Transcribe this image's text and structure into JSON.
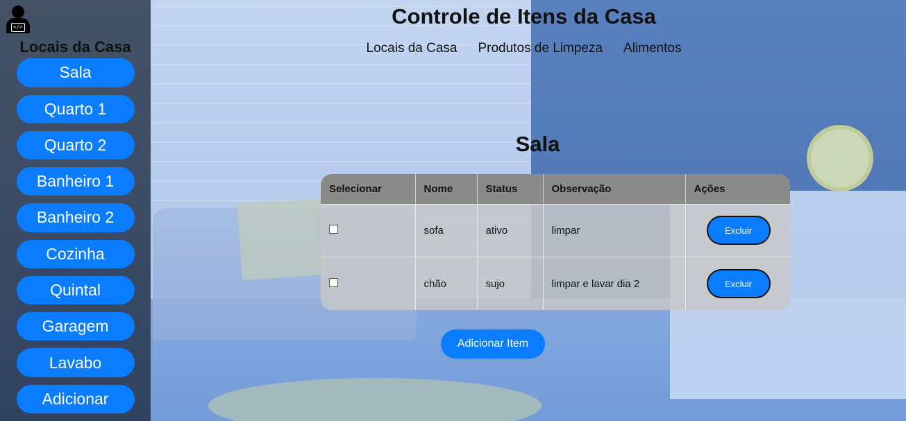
{
  "header": {
    "title": "Controle de Itens da Casa",
    "nav": [
      "Locais da Casa",
      "Produtos de Limpeza",
      "Alimentos"
    ]
  },
  "sidebar": {
    "title": "Locais da Casa",
    "icon": "user-laptop-icon",
    "items": [
      "Sala",
      "Quarto 1",
      "Quarto 2",
      "Banheiro 1",
      "Banheiro 2",
      "Cozinha",
      "Quintal",
      "Garagem",
      "Lavabo",
      "Adicionar"
    ]
  },
  "main": {
    "section_title": "Sala",
    "table": {
      "headers": [
        "Selecionar",
        "Nome",
        "Status",
        "Observação",
        "Ações"
      ],
      "rows": [
        {
          "nome": "sofa",
          "status": "ativo",
          "observacao": "limpar",
          "acao": "Excluir",
          "checked": false
        },
        {
          "nome": "chão",
          "status": "sujo",
          "observacao": "limpar e lavar dia 2",
          "acao": "Excluir",
          "checked": false
        }
      ]
    },
    "add_button": "Adicionar Item"
  },
  "colors": {
    "accent": "#0a7cff",
    "sidebar_bg": "rgba(0,0,0,0.55)",
    "table_header": "#8a8a8a"
  }
}
